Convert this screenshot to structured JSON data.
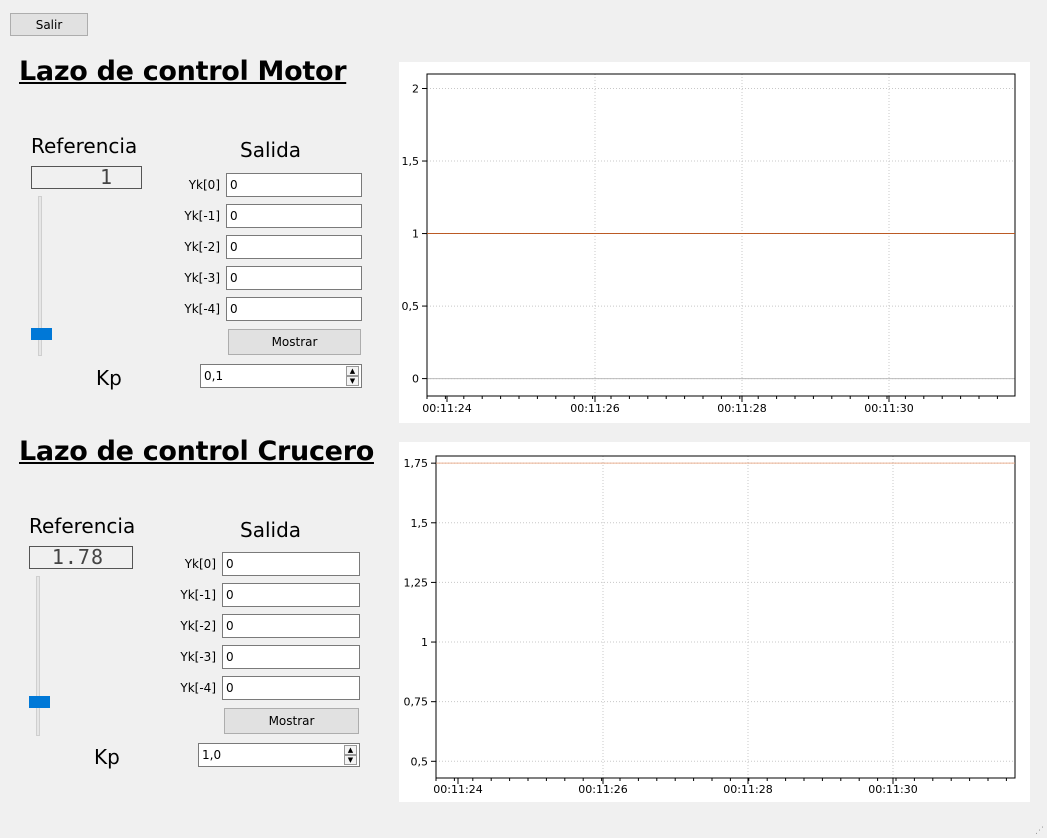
{
  "exit_label": "Salir",
  "panels": [
    {
      "id": "motor",
      "title": "Lazo de control Motor",
      "referencia_label": "Referencia",
      "referencia_display": "1",
      "salida_label": "Salida",
      "outputs": [
        {
          "label": "Yk[0]",
          "value": "0"
        },
        {
          "label": "Yk[-1]",
          "value": "0"
        },
        {
          "label": "Yk[-2]",
          "value": "0"
        },
        {
          "label": "Yk[-3]",
          "value": "0"
        },
        {
          "label": "Yk[-4]",
          "value": "0"
        }
      ],
      "mostrar_label": "Mostrar",
      "kp_label": "Kp",
      "kp_value": "0,1",
      "spin_up": "▲",
      "spin_down": "▼"
    },
    {
      "id": "crucero",
      "title": "Lazo de control Crucero",
      "referencia_label": "Referencia",
      "referencia_display": "1.78",
      "salida_label": "Salida",
      "outputs": [
        {
          "label": "Yk[0]",
          "value": "0"
        },
        {
          "label": "Yk[-1]",
          "value": "0"
        },
        {
          "label": "Yk[-2]",
          "value": "0"
        },
        {
          "label": "Yk[-3]",
          "value": "0"
        },
        {
          "label": "Yk[-4]",
          "value": "0"
        }
      ],
      "mostrar_label": "Mostrar",
      "kp_label": "Kp",
      "kp_value": "1,0",
      "spin_up": "▲",
      "spin_down": "▼"
    }
  ],
  "chart_data": [
    {
      "type": "line",
      "x_ticks": [
        "00:11:24",
        "00:11:26",
        "00:11:28",
        "00:11:30"
      ],
      "y_ticks": [
        "0",
        "0,5",
        "1",
        "1,5",
        "2"
      ],
      "y_tick_values": [
        0,
        0.5,
        1,
        1.5,
        2
      ],
      "ylim": [
        -0.12,
        2.1
      ],
      "grid": true,
      "series": [
        {
          "color": "#3b5aa8",
          "x": [
            0,
            1
          ],
          "values": [
            1,
            1
          ]
        },
        {
          "color": "#d35400",
          "x": [
            0,
            1
          ],
          "values": [
            1,
            1
          ]
        }
      ]
    },
    {
      "type": "line",
      "x_ticks": [
        "00:11:24",
        "00:11:26",
        "00:11:28",
        "00:11:30"
      ],
      "y_ticks": [
        "0,5",
        "0,75",
        "1",
        "1,25",
        "1,5",
        "1,75"
      ],
      "y_tick_values": [
        0.5,
        0.75,
        1,
        1.25,
        1.5,
        1.75
      ],
      "ylim": [
        0.43,
        1.78
      ],
      "grid": true,
      "series": [
        {
          "color": "#e8a07a",
          "x": [
            0,
            1
          ],
          "values": [
            1.75,
            1.75
          ]
        }
      ]
    }
  ]
}
